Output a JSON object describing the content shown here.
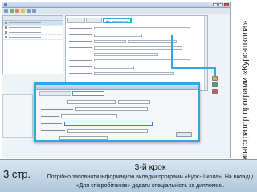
{
  "vertical_caption": "Адміністратор програми «Курс-школа»",
  "bottom_bar": {
    "page_label": "3 стр.",
    "step_title": "3-й крок",
    "step_description": "Потрібно заповнити інформацією вкладки програми «Курс-Школа». На вкладці «Для співробітників» додати спеціальність за дипломом."
  },
  "app_window": {
    "active_tab_label": "Для співробітників"
  },
  "colors": {
    "highlight": "#2fa8df",
    "bottom_bar": "#aec7dc"
  }
}
